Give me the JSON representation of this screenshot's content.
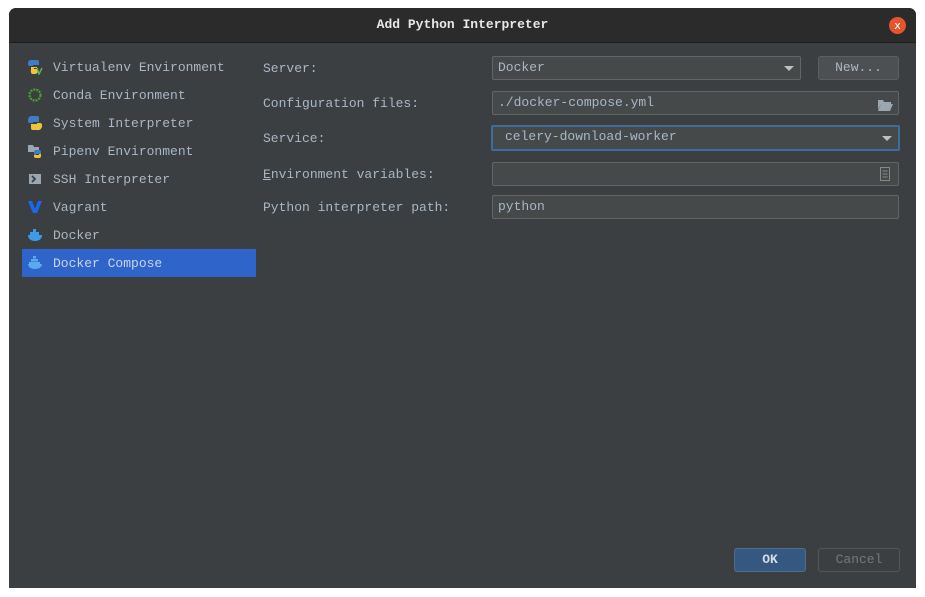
{
  "window": {
    "title": "Add Python Interpreter",
    "close_label": "x"
  },
  "sidebar": {
    "items": [
      {
        "label": "Virtualenv Environment",
        "icon": "virtualenv-icon",
        "selected": false
      },
      {
        "label": "Conda Environment",
        "icon": "conda-icon",
        "selected": false
      },
      {
        "label": "System Interpreter",
        "icon": "python-icon",
        "selected": false
      },
      {
        "label": "Pipenv Environment",
        "icon": "pipenv-icon",
        "selected": false
      },
      {
        "label": "SSH Interpreter",
        "icon": "ssh-terminal-icon",
        "selected": false
      },
      {
        "label": "Vagrant",
        "icon": "vagrant-icon",
        "selected": false
      },
      {
        "label": "Docker",
        "icon": "docker-icon",
        "selected": false
      },
      {
        "label": "Docker Compose",
        "icon": "docker-compose-icon",
        "selected": true
      }
    ]
  },
  "form": {
    "server": {
      "label": "Server:",
      "value": "Docker",
      "new_button": "New..."
    },
    "config_files": {
      "label": "Configuration files:",
      "value": "./docker-compose.yml"
    },
    "service": {
      "label": "Service:",
      "value": "celery-download-worker"
    },
    "env_vars": {
      "label_mnemonic": "E",
      "label_rest": "nvironment variables:",
      "value": ""
    },
    "interpreter_path": {
      "label": "Python interpreter path:",
      "value": "python"
    }
  },
  "footer": {
    "ok_label": "OK",
    "cancel_label": "Cancel"
  },
  "colors": {
    "selection": "#2f65ca",
    "close": "#e4552b",
    "primary_button": "#365880",
    "focus_border": "#3d6d9c"
  }
}
